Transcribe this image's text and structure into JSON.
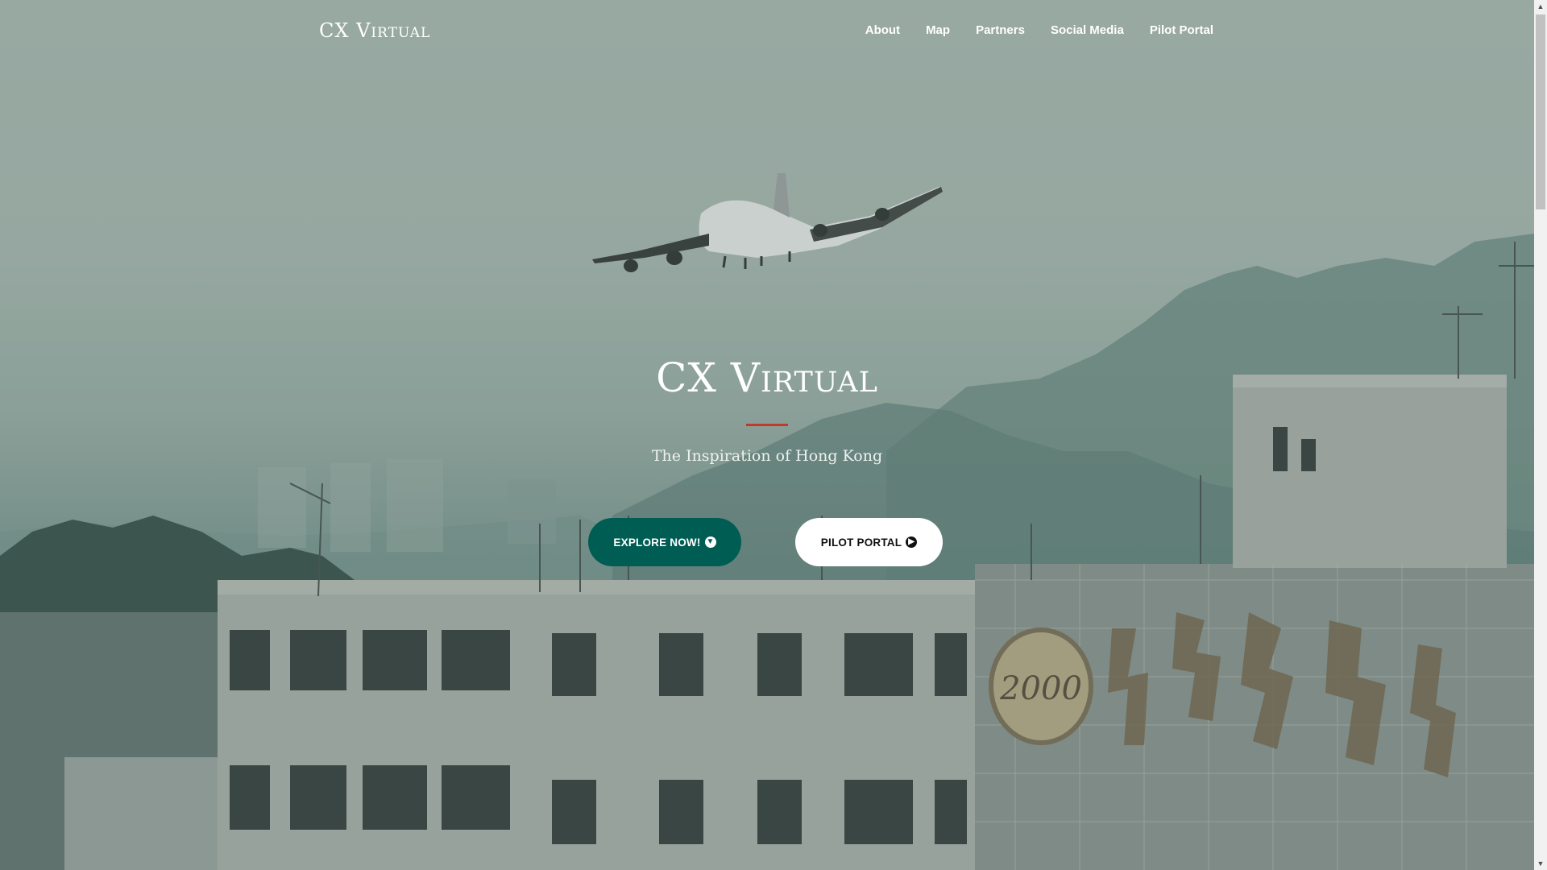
{
  "brand": {
    "name": "CX Virtual"
  },
  "nav": {
    "links": [
      {
        "label": "About"
      },
      {
        "label": "Map"
      },
      {
        "label": "Partners"
      },
      {
        "label": "Social Media"
      },
      {
        "label": "Pilot Portal"
      }
    ]
  },
  "hero": {
    "title": "CX Virtual",
    "subtitle": "The Inspiration of Hong Kong",
    "buttons": {
      "explore": {
        "label": "EXPLORE NOW!",
        "icon": "arrow-circle-down-icon"
      },
      "portal": {
        "label": "PILOT PORTAL",
        "icon": "arrow-circle-right-icon"
      }
    },
    "background": "Boeing 747 landing over Kowloon buildings",
    "sign_text": "2000"
  },
  "colors": {
    "accent_teal": "#005d53",
    "divider_red": "#c0392b",
    "text_white": "#ffffff"
  }
}
